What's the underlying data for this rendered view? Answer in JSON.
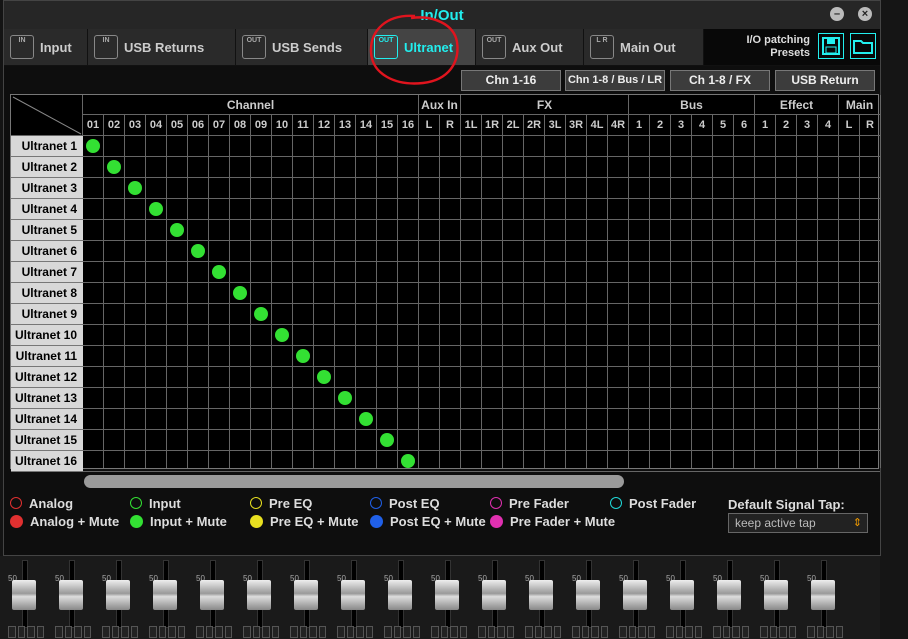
{
  "window": {
    "title": "In/Out"
  },
  "tabs": [
    {
      "label": "Input",
      "icon_text": "IN"
    },
    {
      "label": "USB Returns",
      "icon_text": "IN"
    },
    {
      "label": "USB Sends",
      "icon_text": "OUT"
    },
    {
      "label": "Ultranet",
      "icon_text": "OUT",
      "active": true
    },
    {
      "label": "Aux Out",
      "icon_text": "OUT"
    },
    {
      "label": "Main Out",
      "icon_text": "L R"
    }
  ],
  "presets": {
    "label": "I/O patching\nPresets",
    "save_icon": "save-icon",
    "open_icon": "folder-icon"
  },
  "view_buttons": [
    "Chn 1-16",
    "Chn 1-8 / Bus / LR",
    "Ch 1-8 / FX",
    "USB Return"
  ],
  "matrix": {
    "groups": [
      {
        "label": "Channel",
        "cols": 16
      },
      {
        "label": "Aux In",
        "cols": 2
      },
      {
        "label": "FX",
        "cols": 8
      },
      {
        "label": "Bus",
        "cols": 6
      },
      {
        "label": "Effect",
        "cols": 4
      },
      {
        "label": "Main",
        "cols": 2
      }
    ],
    "columns": [
      "01",
      "02",
      "03",
      "04",
      "05",
      "06",
      "07",
      "08",
      "09",
      "10",
      "11",
      "12",
      "13",
      "14",
      "15",
      "16",
      "L",
      "R",
      "1L",
      "1R",
      "2L",
      "2R",
      "3L",
      "3R",
      "4L",
      "4R",
      "1",
      "2",
      "3",
      "4",
      "5",
      "6",
      "1",
      "2",
      "3",
      "4",
      "L",
      "R"
    ],
    "rows": [
      "Ultranet 1",
      "Ultranet 2",
      "Ultranet 3",
      "Ultranet 4",
      "Ultranet 5",
      "Ultranet 6",
      "Ultranet 7",
      "Ultranet 8",
      "Ultranet 9",
      "Ultranet 10",
      "Ultranet 11",
      "Ultranet 12",
      "Ultranet 13",
      "Ultranet 14",
      "Ultranet 15",
      "Ultranet 16"
    ],
    "routes": [
      [
        0,
        0
      ],
      [
        1,
        1
      ],
      [
        2,
        2
      ],
      [
        3,
        3
      ],
      [
        4,
        4
      ],
      [
        5,
        5
      ],
      [
        6,
        6
      ],
      [
        7,
        7
      ],
      [
        8,
        8
      ],
      [
        9,
        9
      ],
      [
        10,
        10
      ],
      [
        11,
        11
      ],
      [
        12,
        12
      ],
      [
        13,
        13
      ],
      [
        14,
        14
      ],
      [
        15,
        15
      ]
    ],
    "route_color": "#33e033"
  },
  "legend": [
    {
      "label": "Analog",
      "color": "#e03030",
      "style": "ring"
    },
    {
      "label": "Input",
      "color": "#33e033",
      "style": "ring"
    },
    {
      "label": "Pre EQ",
      "color": "#e8e020",
      "style": "ring"
    },
    {
      "label": "Post EQ",
      "color": "#2060e8",
      "style": "ring"
    },
    {
      "label": "Pre Fader",
      "color": "#e030b0",
      "style": "ring"
    },
    {
      "label": "Post Fader",
      "color": "#20d8d8",
      "style": "ring"
    },
    {
      "label": "Analog + Mute",
      "color": "#e03030",
      "style": "fill"
    },
    {
      "label": "Input + Mute",
      "color": "#33e033",
      "style": "fill"
    },
    {
      "label": "Pre EQ + Mute",
      "color": "#e8e020",
      "style": "fill"
    },
    {
      "label": "Post EQ + Mute",
      "color": "#2060e8",
      "style": "fill"
    },
    {
      "label": "Pre Fader + Mute",
      "color": "#e030b0",
      "style": "fill"
    }
  ],
  "default_tap": {
    "label": "Default Signal Tap:",
    "value": "keep active tap"
  },
  "background": {
    "fader_scale": "50",
    "right_edge_value": "3"
  }
}
